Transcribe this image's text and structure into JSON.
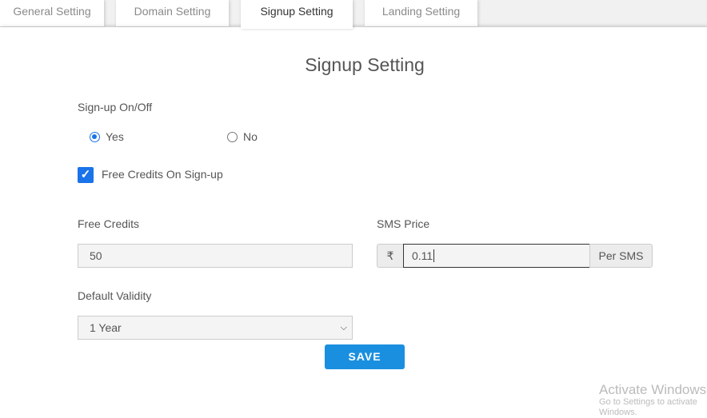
{
  "tabs": [
    {
      "label": "General Setting"
    },
    {
      "label": "Domain Setting"
    },
    {
      "label": "Signup Setting",
      "active": true
    },
    {
      "label": "Landing Setting"
    }
  ],
  "page_title": "Signup Setting",
  "signup_toggle": {
    "label": "Sign-up On/Off",
    "options": [
      {
        "label": "Yes",
        "selected": true
      },
      {
        "label": "No",
        "selected": false
      }
    ]
  },
  "free_credits_checkbox": {
    "label": "Free Credits On Sign-up",
    "checked": true
  },
  "free_credits": {
    "label": "Free Credits",
    "value": "50"
  },
  "sms_price": {
    "label": "SMS Price",
    "currency": "₹",
    "value": "0.11",
    "suffix": "Per SMS"
  },
  "default_validity": {
    "label": "Default Validity",
    "selected": "1 Year"
  },
  "save_label": "SAVE",
  "watermark": {
    "line1": "Activate Windows",
    "line2": "Go to Settings to activate Windows."
  },
  "colors": {
    "accent": "#1a73e8",
    "save_button": "#1a8fe0"
  }
}
